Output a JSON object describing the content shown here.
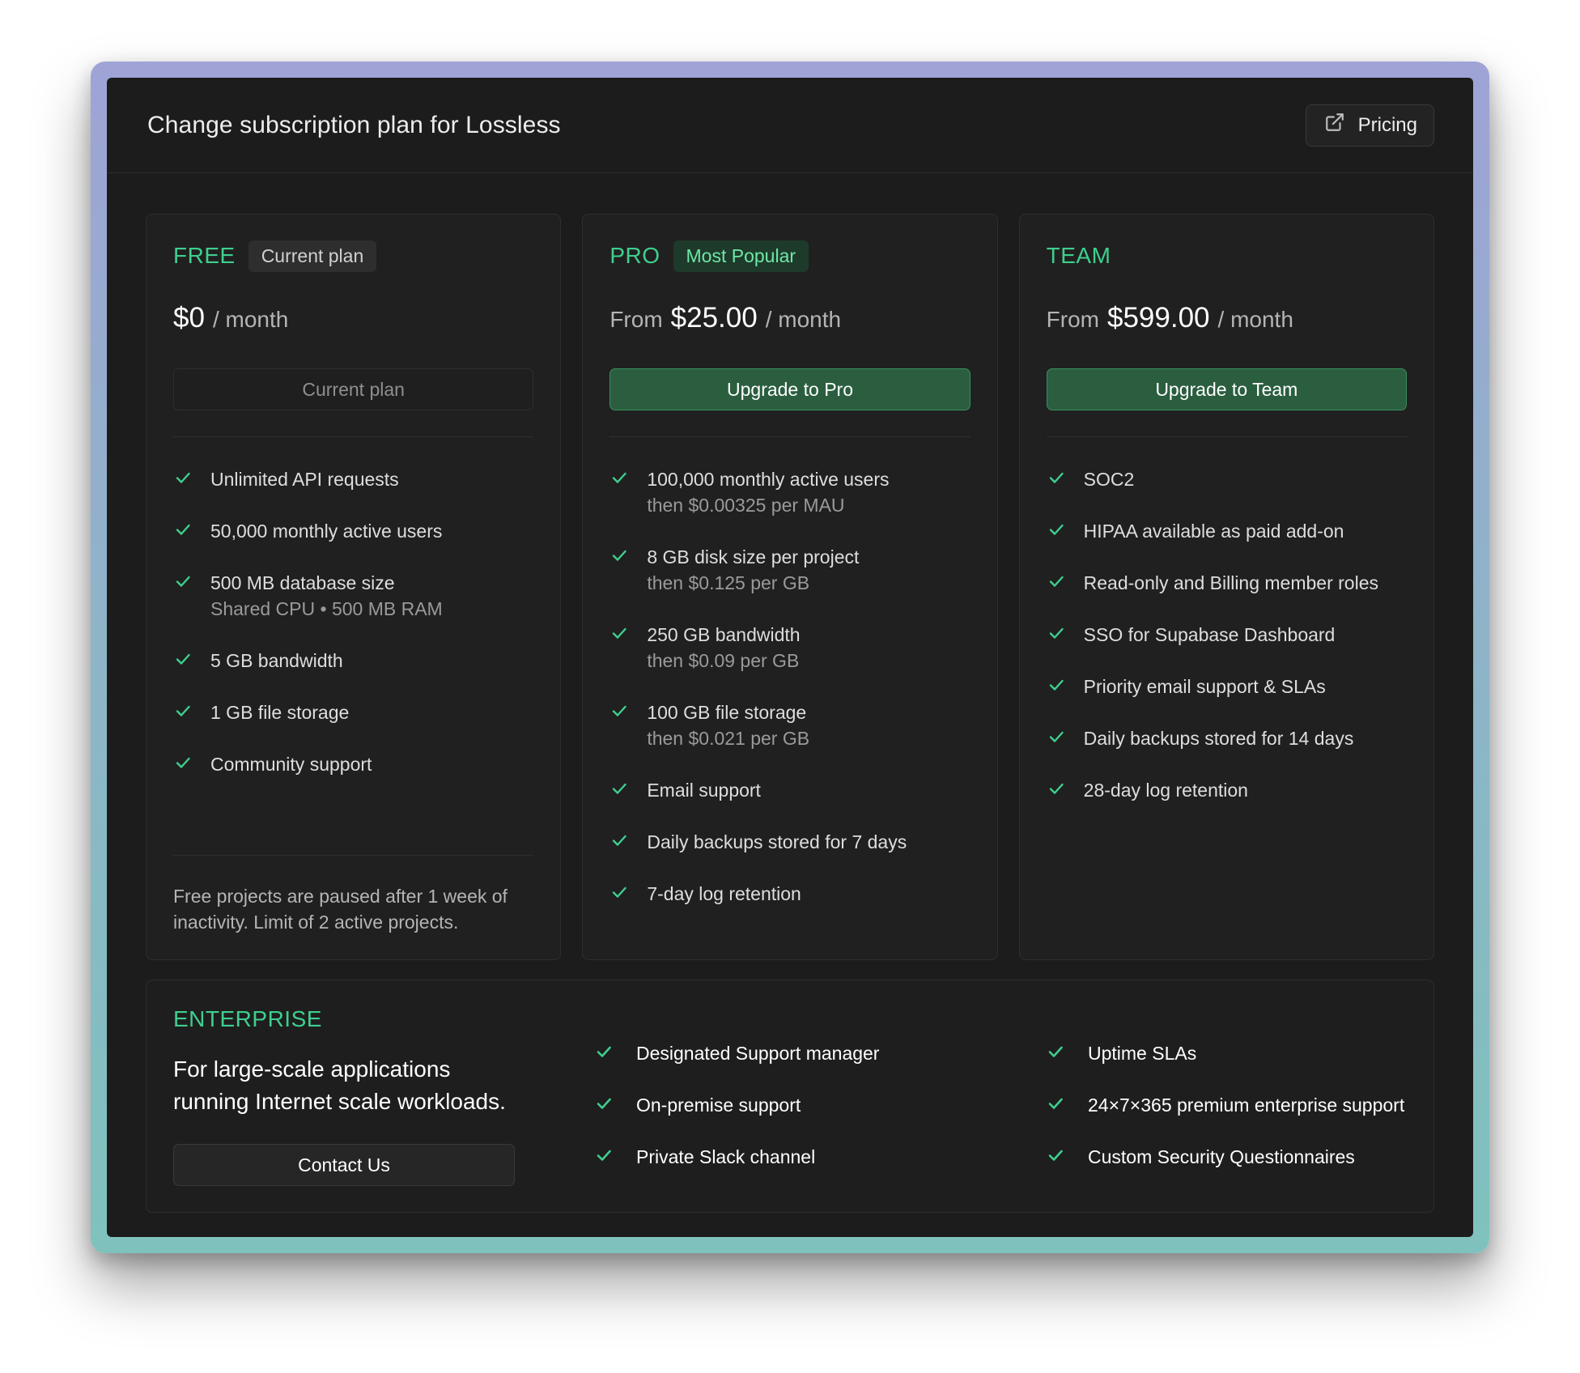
{
  "header": {
    "title": "Change subscription plan for Lossless",
    "pricing_label": "Pricing",
    "pricing_icon": "external-link-icon"
  },
  "plans": [
    {
      "name": "FREE",
      "badge": "Current plan",
      "price_prefix": "",
      "price": "$0",
      "price_suffix": "/ month",
      "button_label": "Current plan",
      "button_enabled": false,
      "features": [
        {
          "text": "Unlimited API requests",
          "sub": ""
        },
        {
          "text": "50,000 monthly active users",
          "sub": ""
        },
        {
          "text": "500 MB database size",
          "sub": "Shared CPU • 500 MB RAM"
        },
        {
          "text": "5 GB bandwidth",
          "sub": ""
        },
        {
          "text": "1 GB file storage",
          "sub": ""
        },
        {
          "text": "Community support",
          "sub": ""
        }
      ],
      "footnote": "Free projects are paused after 1 week of inactivity. Limit of 2 active projects."
    },
    {
      "name": "PRO",
      "badge": "Most Popular",
      "price_prefix": "From",
      "price": "$25.00",
      "price_suffix": "/ month",
      "button_label": "Upgrade to Pro",
      "button_enabled": true,
      "features": [
        {
          "text": "100,000 monthly active users",
          "sub": "then $0.00325 per MAU"
        },
        {
          "text": "8 GB disk size per project",
          "sub": "then $0.125 per GB"
        },
        {
          "text": "250 GB bandwidth",
          "sub": "then $0.09 per GB"
        },
        {
          "text": "100 GB file storage",
          "sub": "then $0.021 per GB"
        },
        {
          "text": "Email support",
          "sub": ""
        },
        {
          "text": "Daily backups stored for 7 days",
          "sub": ""
        },
        {
          "text": "7-day log retention",
          "sub": ""
        }
      ]
    },
    {
      "name": "TEAM",
      "badge": "",
      "price_prefix": "From",
      "price": "$599.00",
      "price_suffix": "/ month",
      "button_label": "Upgrade to Team",
      "button_enabled": true,
      "features": [
        {
          "text": "SOC2",
          "sub": ""
        },
        {
          "text": "HIPAA available as paid add-on",
          "sub": ""
        },
        {
          "text": "Read-only and Billing member roles",
          "sub": ""
        },
        {
          "text": "SSO for Supabase Dashboard",
          "sub": ""
        },
        {
          "text": "Priority email support & SLAs",
          "sub": ""
        },
        {
          "text": "Daily backups stored for 14 days",
          "sub": ""
        },
        {
          "text": "28-day log retention",
          "sub": ""
        }
      ]
    }
  ],
  "enterprise": {
    "name": "ENTERPRISE",
    "description": "For large-scale applications running Internet scale workloads.",
    "button_label": "Contact Us",
    "features_col1": [
      "Designated Support manager",
      "On-premise support",
      "Private Slack channel"
    ],
    "features_col2": [
      "Uptime SLAs",
      "24×7×365 premium enterprise support",
      "Custom Security Questionnaires"
    ]
  },
  "colors": {
    "accent": "#3ecf8e",
    "primary_button": "#2a5e3f",
    "background": "#1c1c1c"
  }
}
